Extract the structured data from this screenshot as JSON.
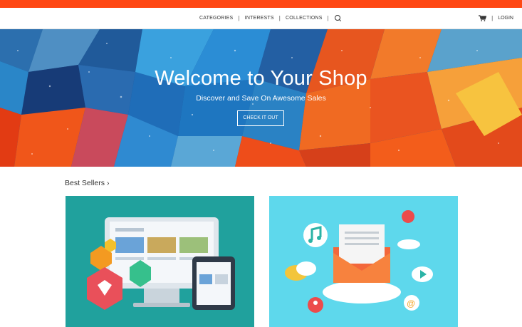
{
  "colors": {
    "accent": "#ff4713",
    "card1_bg": "#20a19d",
    "card2_bg": "#5ed8ec"
  },
  "nav": {
    "items": [
      {
        "label": "CATEGORIES"
      },
      {
        "label": "INTERESTS"
      },
      {
        "label": "COLLECTIONS"
      }
    ],
    "search_icon": "search-icon",
    "cart_icon": "cart-icon",
    "login_label": "LOGIN"
  },
  "hero": {
    "title": "Welcome to Your Shop",
    "subtitle": "Discover and Save On Awesome Sales",
    "button_label": "CHECK IT OUT"
  },
  "best_sellers": {
    "title": "Best Sellers",
    "chevron_icon": "chevron-right-icon",
    "cards": [
      {
        "icon": "ecommerce-devices-illustration"
      },
      {
        "icon": "email-marketing-illustration"
      }
    ]
  }
}
